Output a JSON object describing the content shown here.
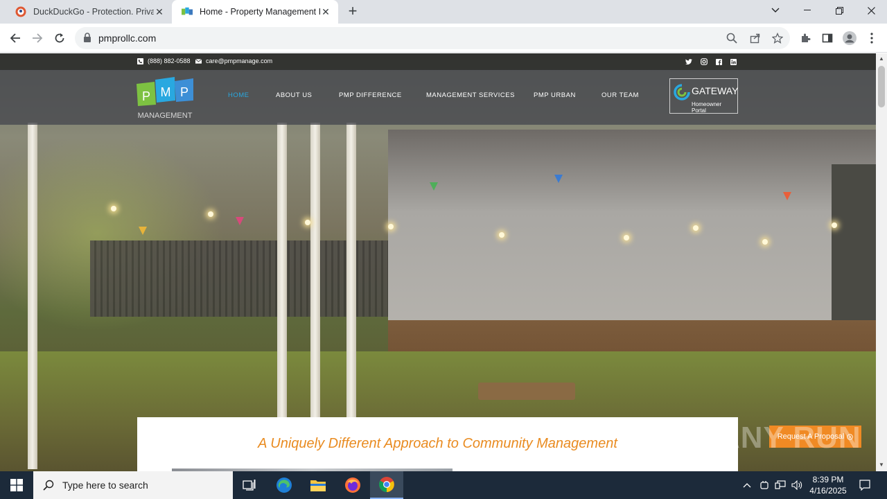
{
  "browser": {
    "tabs": [
      {
        "title": "DuckDuckGo - Protection. Privac",
        "favicon": "duckduckgo-icon",
        "active": false
      },
      {
        "title": "Home - Property Management I",
        "favicon": "pmp-favicon",
        "active": true
      }
    ],
    "url": "pmprollc.com"
  },
  "site": {
    "contact": {
      "phone": "(888) 882-0588",
      "email": "care@pmpmanage.com"
    },
    "social_icons": [
      "twitter-icon",
      "instagram-icon",
      "facebook-icon",
      "linkedin-icon"
    ],
    "logo": {
      "letters": [
        "P",
        "M",
        "P"
      ],
      "subtitle": "MANAGEMENT"
    },
    "nav": [
      {
        "label": "HOME",
        "active": true
      },
      {
        "label": "ABOUT US",
        "active": false
      },
      {
        "label": "PMP DIFFERENCE",
        "active": false
      },
      {
        "label": "MANAGEMENT SERVICES",
        "active": false
      },
      {
        "label": "PMP URBAN",
        "active": false
      },
      {
        "label": "OUR TEAM",
        "active": false
      }
    ],
    "gateway": {
      "title": "GATEWAY",
      "subtitle": "Homeowner Portal"
    },
    "tagline": "A Uniquely Different Approach to Community Management",
    "proposal_button": "Request A Proposal",
    "watermark": "ANY RUN",
    "colors": {
      "accent_blue": "#29a8e0",
      "accent_orange": "#e98b20",
      "logo_green": "#7dc242",
      "logo_blue": "#29a8e0"
    }
  },
  "taskbar": {
    "search_placeholder": "Type here to search",
    "time": "8:39 PM",
    "date": "4/16/2025"
  }
}
